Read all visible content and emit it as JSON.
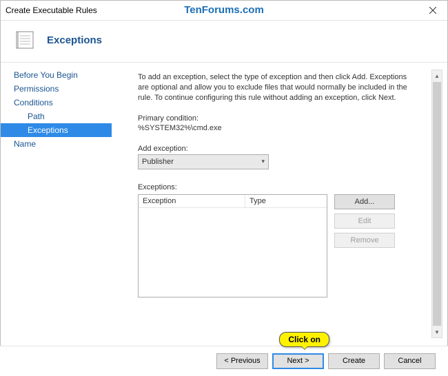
{
  "window": {
    "title": "Create Executable Rules",
    "watermark": "TenForums.com"
  },
  "header": {
    "title": "Exceptions"
  },
  "sidebar": {
    "items": [
      {
        "label": "Before You Begin"
      },
      {
        "label": "Permissions"
      },
      {
        "label": "Conditions"
      },
      {
        "label": "Path"
      },
      {
        "label": "Exceptions"
      },
      {
        "label": "Name"
      }
    ]
  },
  "content": {
    "intro": "To add an exception, select the type of exception and then click Add. Exceptions are optional and allow you to exclude files that would normally be included in the rule. To continue configuring this rule without adding an exception, click Next.",
    "primary_condition_label": "Primary condition:",
    "primary_condition_value": "%SYSTEM32%\\cmd.exe",
    "add_exception_label": "Add exception:",
    "add_exception_value": "Publisher",
    "exceptions_label": "Exceptions:",
    "list_cols": {
      "col1": "Exception",
      "col2": "Type"
    },
    "buttons": {
      "add": "Add...",
      "edit": "Edit",
      "remove": "Remove"
    }
  },
  "footer": {
    "previous": "< Previous",
    "next": "Next >",
    "create": "Create",
    "cancel": "Cancel"
  },
  "annotation": {
    "callout": "Click on"
  }
}
